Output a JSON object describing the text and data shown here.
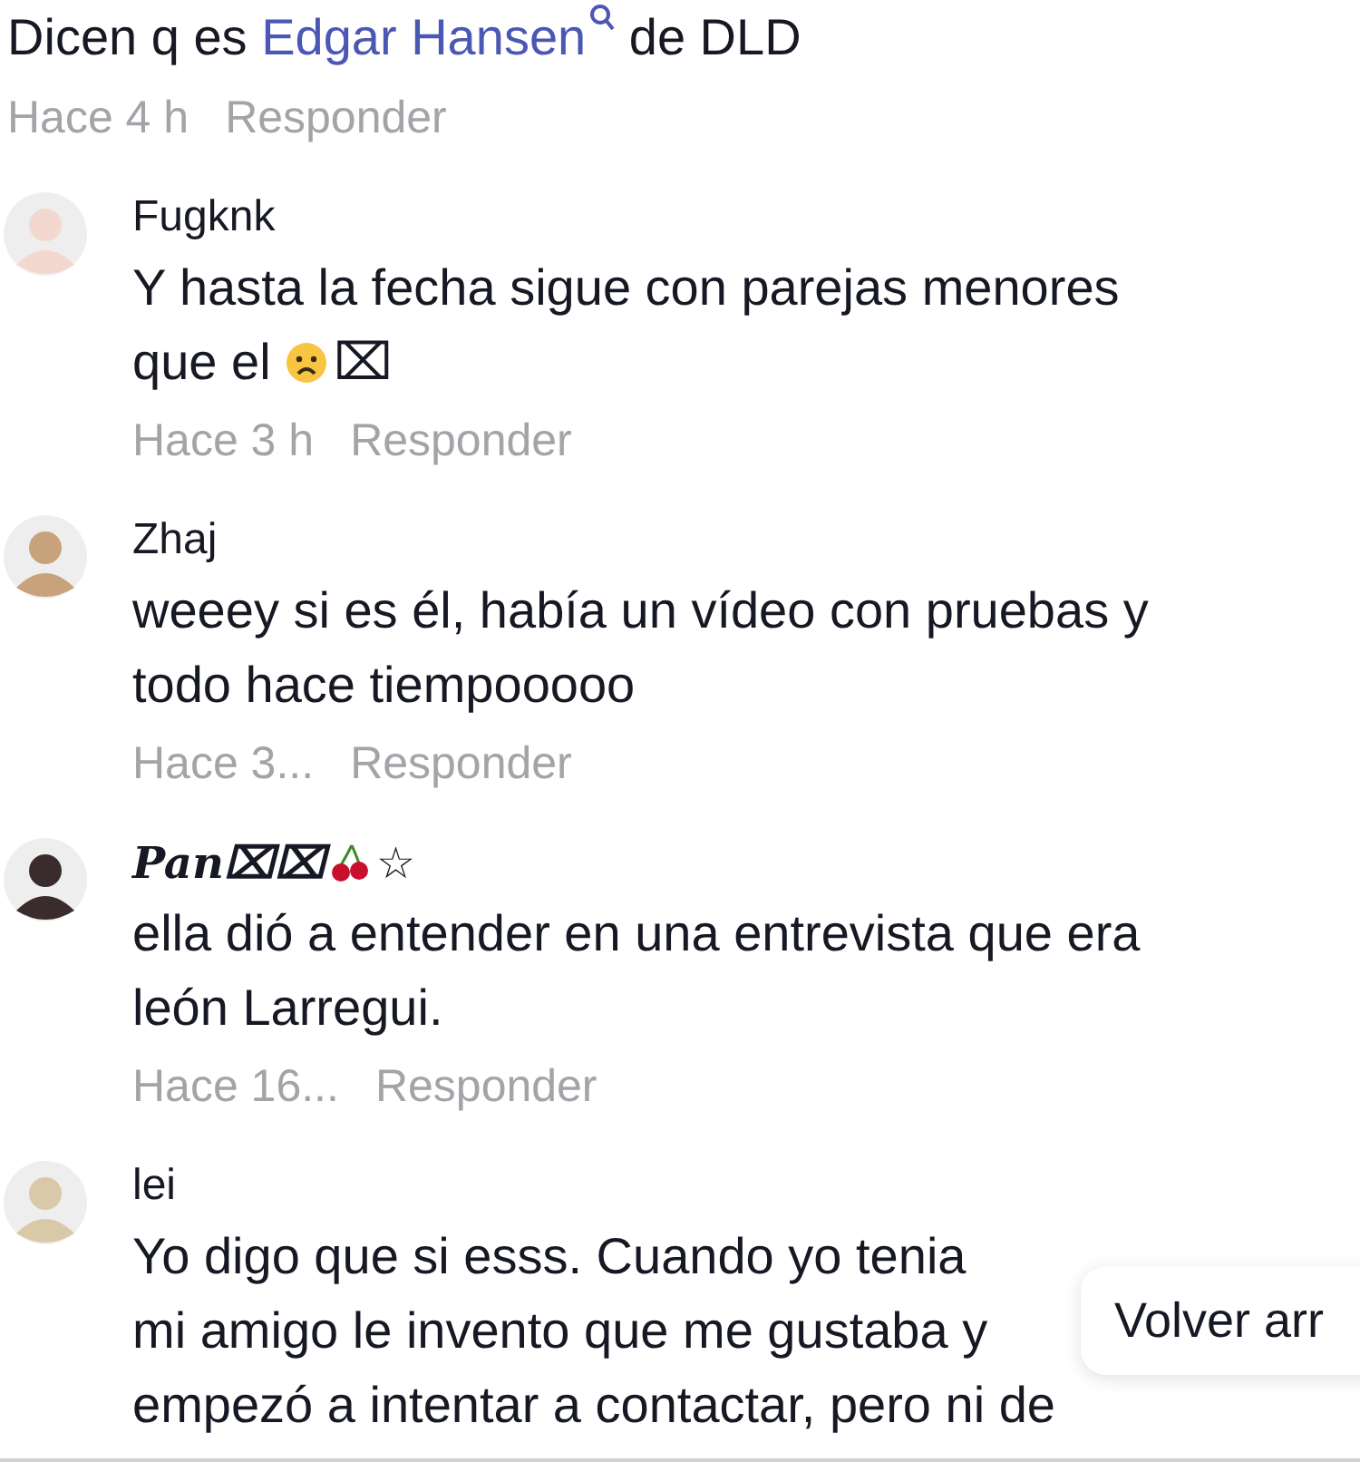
{
  "top_comment": {
    "parts": [
      {
        "kind": "plain",
        "text": "Dicen q es "
      },
      {
        "kind": "link",
        "text": "Edgar Hansen"
      },
      {
        "kind": "plain",
        "text": " de DLD"
      }
    ],
    "time": "Hace 4 h",
    "reply": "Responder"
  },
  "comments": [
    {
      "kind": "plain",
      "name": [
        {
          "kind": "text",
          "text": "Fugknk"
        }
      ],
      "lines": [
        [
          {
            "kind": "text",
            "text": "Y hasta la fecha sigue con parejas menores"
          }
        ],
        [
          {
            "kind": "text",
            "text": "que el "
          },
          {
            "kind": "sad_face"
          },
          {
            "kind": "text",
            "text": "⌧"
          }
        ]
      ],
      "time": "Hace 3 h",
      "reply": "Responder"
    },
    {
      "kind": "plain",
      "name": [
        {
          "kind": "text",
          "text": "Zhaj"
        }
      ],
      "lines": [
        [
          {
            "kind": "text",
            "text": "weeey si es él, había un vídeo con pruebas y"
          }
        ],
        [
          {
            "kind": "text",
            "text": "todo hace tiempooooo"
          }
        ]
      ],
      "time": "Hace 3...",
      "reply": "Responder"
    },
    {
      "kind": "fancy",
      "name": [
        {
          "kind": "text",
          "text": "Pan⌧⌧"
        },
        {
          "kind": "cherry"
        },
        {
          "kind": "text",
          "text": "☆"
        }
      ],
      "lines": [
        [
          {
            "kind": "text",
            "text": "ella dió a entender en una entrevista que era"
          }
        ],
        [
          {
            "kind": "text",
            "text": "león Larregui."
          }
        ]
      ],
      "time": "Hace 16...",
      "reply": "Responder"
    },
    {
      "kind": "plain",
      "name": [
        {
          "kind": "text",
          "text": "lei"
        }
      ],
      "lines": [
        [
          {
            "kind": "text",
            "text": "Yo digo que si esss. Cuando yo tenia"
          }
        ],
        [
          {
            "kind": "text",
            "text": "mi amigo le invento que me gustaba y"
          }
        ],
        [
          {
            "kind": "text",
            "text": "empezó a intentar a contactar, pero ni de"
          }
        ]
      ]
    }
  ],
  "back_to_top": {
    "label": "Volver arr"
  }
}
